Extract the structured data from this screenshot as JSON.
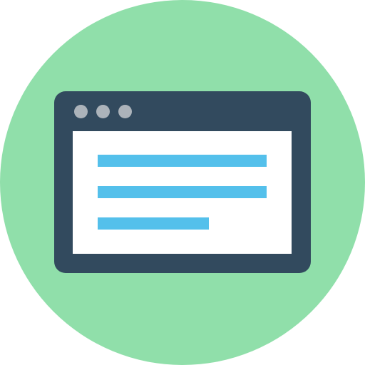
{
  "colors": {
    "background_circle": "#90DFAA",
    "window_frame": "#324A5E",
    "window_dots": "#ACB3BA",
    "content_area": "#FFFFFF",
    "text_lines": "#54C0EB"
  },
  "icon": {
    "name": "browser-window-icon",
    "dots": [
      "window-dot-icon",
      "window-dot-icon",
      "window-dot-icon"
    ],
    "text_lines": 3
  }
}
